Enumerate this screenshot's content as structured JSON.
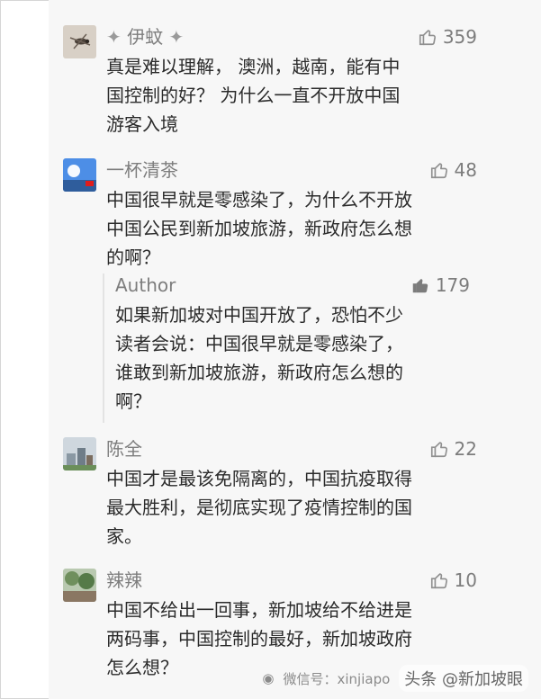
{
  "comments": [
    {
      "name": "伊蚊",
      "likes": "359",
      "text": "真是难以理解， 澳洲，越南，能有中\n国控制的好？  为什么一直不开放中国\n游客入境"
    },
    {
      "name": "一杯清茶",
      "likes": "48",
      "text": "中国很早就是零感染了，为什么不开放\n中国公民到新加坡旅游，新政府怎么想\n的啊？"
    },
    {
      "name": "陈全",
      "likes": "22",
      "text": "中国才是最该免隔离的，中国抗疫取得\n最大胜利，是彻底实现了疫情控制的国\n家。"
    },
    {
      "name": "辣辣",
      "likes": "10",
      "text": "中国不给出一回事，新加坡给不给进是\n两码事，中国控制的最好，新加坡政府\n怎么想？"
    }
  ],
  "reply": {
    "name": "Author",
    "likes": "179",
    "text": "如果新加坡对中国开放了，恐怕不少\n读者会说：中国很早就是零感染了，\n谁敢到新加坡旅游，新政府怎么想的\n啊？"
  },
  "watermark": {
    "left": "微信号：xinjiapo",
    "right": "头条 @新加坡眼"
  },
  "colors": {
    "panel_bg": "#f7f7f7",
    "text_main": "#2b2b2b",
    "text_meta": "#7d7d7d",
    "thumb_outline": "#8f8f8f",
    "thumb_filled": "#7c7c7c"
  },
  "icons": {
    "like": "thumbs-up-icon",
    "like_filled": "thumbs-up-filled-icon",
    "wechat": "wechat-icon"
  }
}
